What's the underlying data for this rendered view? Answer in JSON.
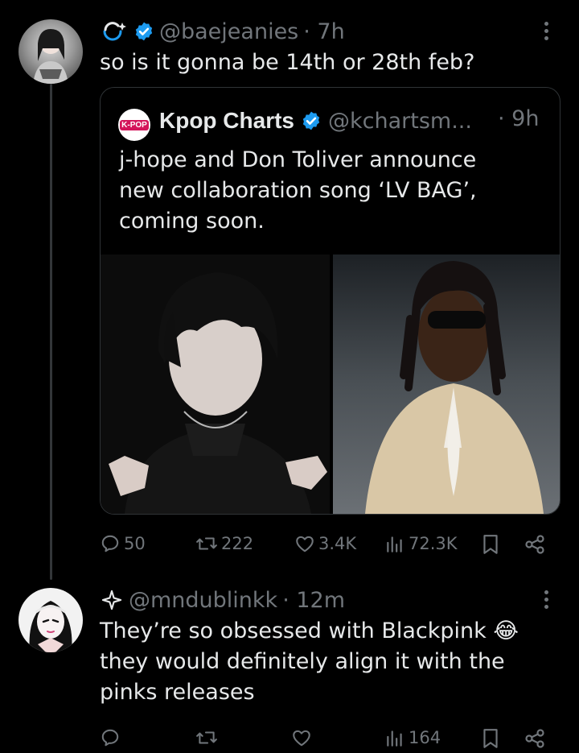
{
  "tweet1": {
    "handle": "@baejeanies",
    "time": "· 7h",
    "text": "so is it gonna be 14th or 28th feb?"
  },
  "quote": {
    "avatar_text": "K-POP",
    "name": "Kpop Charts",
    "handle": "@kchartsm...",
    "time": "· 9h",
    "text_lines": [
      "j-hope and Don Toliver announce",
      "new collaboration song ‘LV BAG’,",
      "coming soon."
    ]
  },
  "tweet1_actions": {
    "replies": "50",
    "retweets": "222",
    "likes": "3.4K",
    "views": "72.3K"
  },
  "tweet2": {
    "handle": "@mndublinkk",
    "time": "· 12m",
    "text_lines": [
      "They’re so obsessed with Blackpink 😂",
      "they would definitely align it with the",
      "pinks releases"
    ]
  },
  "tweet2_actions": {
    "replies": "",
    "retweets": "",
    "likes": "",
    "views": "164"
  },
  "colors": {
    "verified": "#1d9bf0",
    "muted": "#71767b",
    "text": "#e7e9ea",
    "border": "#2f3336"
  }
}
